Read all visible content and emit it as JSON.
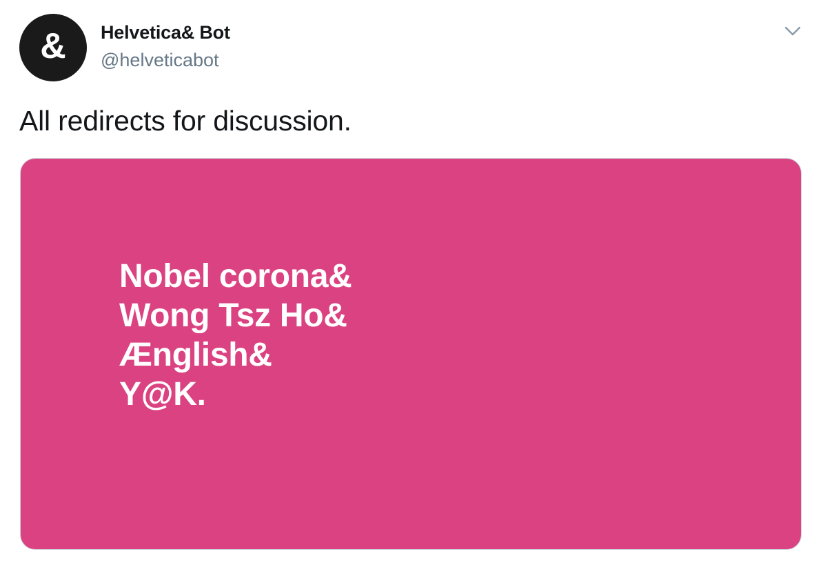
{
  "tweet": {
    "avatar": {
      "glyph": "&",
      "background": "#1a1a1a"
    },
    "display_name": "Helvetica& Bot",
    "handle": "@helveticabot",
    "menu_icon": "chevron-down-icon",
    "text": "All redirects for discussion."
  },
  "media": {
    "background": "#db4282",
    "lines": [
      "Nobel corona&",
      "Wong Tsz Ho&",
      "Ænglish&",
      "Y@K."
    ]
  }
}
